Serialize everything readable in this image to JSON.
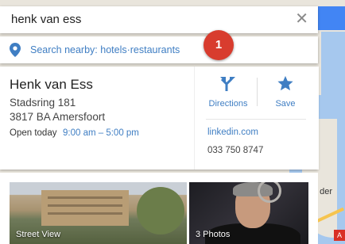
{
  "search": {
    "query": "henk van ess"
  },
  "nearby": {
    "label": "Search nearby: hotels·restaurants"
  },
  "step_badge": "1",
  "place": {
    "name": "Henk van Ess",
    "address_line1": "Stadsring 181",
    "address_line2": "3817 BA Amersfoort",
    "hours_label": "Open today",
    "hours_value": "9:00 am – 5:00 pm",
    "website": "linkedin.com",
    "phone": "033 750 8747"
  },
  "actions": {
    "directions": "Directions",
    "save": "Save"
  },
  "photos": {
    "street_view": "Street View",
    "photos_count": "3 Photos"
  },
  "map": {
    "partial_label": "der",
    "badge": "A"
  },
  "icons": {
    "clear": "close-icon",
    "pin": "location-pin-icon",
    "directions": "directions-icon",
    "save": "star-icon"
  },
  "colors": {
    "link": "#3f7ec3",
    "badge": "#d83c2e",
    "accent": "#4285f4"
  }
}
